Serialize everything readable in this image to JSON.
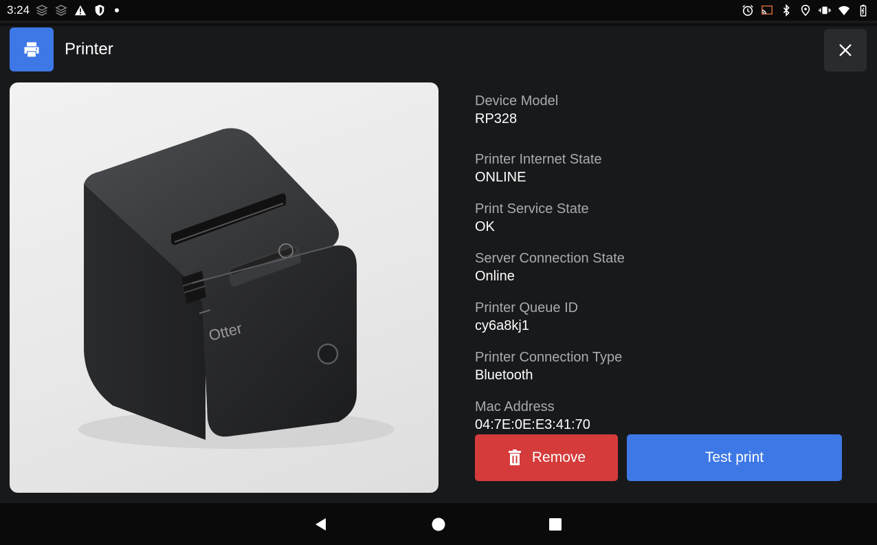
{
  "status_bar": {
    "time": "3:24",
    "left_icons": [
      "layers-icon",
      "layers-icon",
      "warning-icon",
      "shield-icon"
    ],
    "right_icons": [
      "alarm-icon",
      "cast-icon",
      "bluetooth-icon",
      "location-icon",
      "vibrate-icon",
      "wifi-icon",
      "battery-icon"
    ]
  },
  "header": {
    "title": "Printer",
    "icon": "printer-icon",
    "close_icon": "close-icon"
  },
  "details": [
    {
      "label": "Device Model",
      "value": "RP328"
    },
    {
      "label": "Printer Internet State",
      "value": "ONLINE"
    },
    {
      "label": "Print Service State",
      "value": "OK"
    },
    {
      "label": "Server Connection State",
      "value": "Online"
    },
    {
      "label": "Printer Queue ID",
      "value": "cy6a8kj1"
    },
    {
      "label": "Printer Connection Type",
      "value": "Bluetooth"
    },
    {
      "label": "Mac Address",
      "value": "04:7E:0E:E3:41:70"
    }
  ],
  "product": {
    "brand_text": "Otter"
  },
  "actions": {
    "remove_label": "Remove",
    "test_print_label": "Test print"
  },
  "colors": {
    "accent_blue": "#3d78e6",
    "danger_red": "#d53b3b",
    "surface": "#18191b"
  }
}
